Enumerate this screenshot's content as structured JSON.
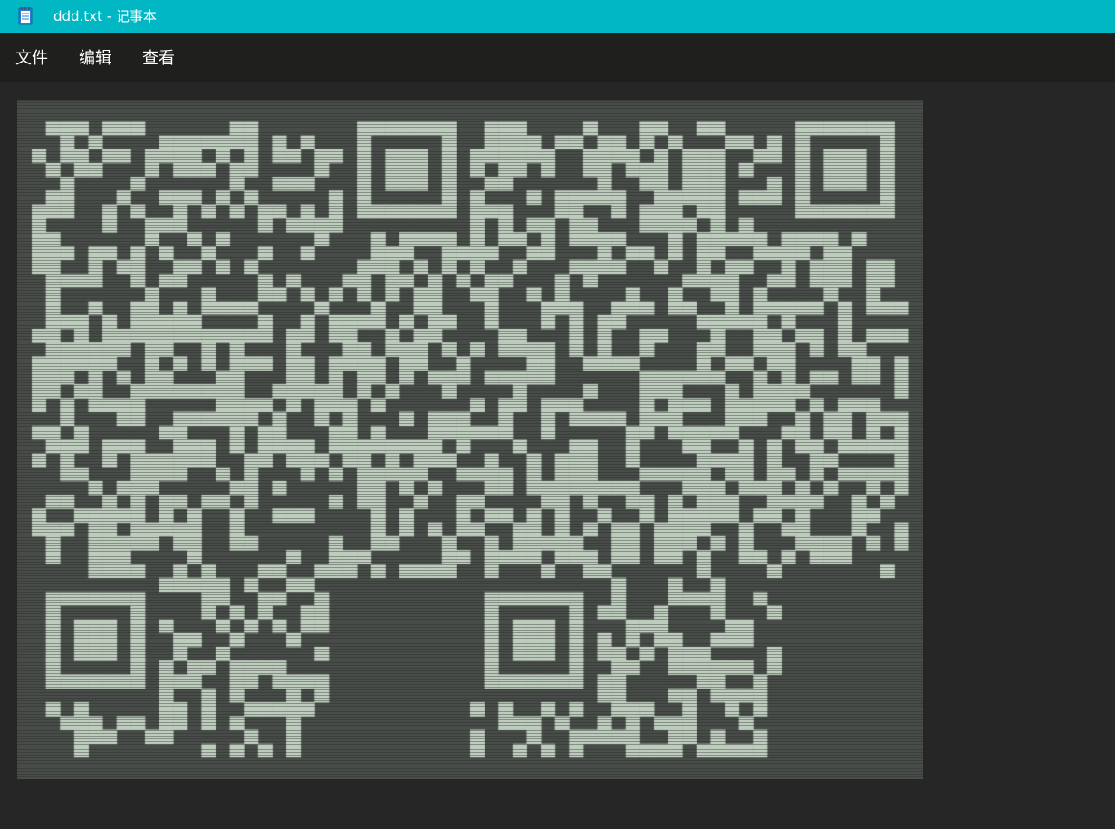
{
  "window": {
    "title": "ddd.txt - 记事本",
    "icon": "notepad-icon",
    "colors": {
      "titlebar": "#00b7c3",
      "menubar": "#1f201e",
      "background": "#262626",
      "text_light": "#c8d8c8",
      "text_dark": "#4a4e4b"
    }
  },
  "menu": {
    "items": [
      {
        "label": "文件"
      },
      {
        "label": "编辑"
      },
      {
        "label": "查看"
      }
    ]
  },
  "editor": {
    "content_description": "QR code pattern rendered as text characters"
  }
}
